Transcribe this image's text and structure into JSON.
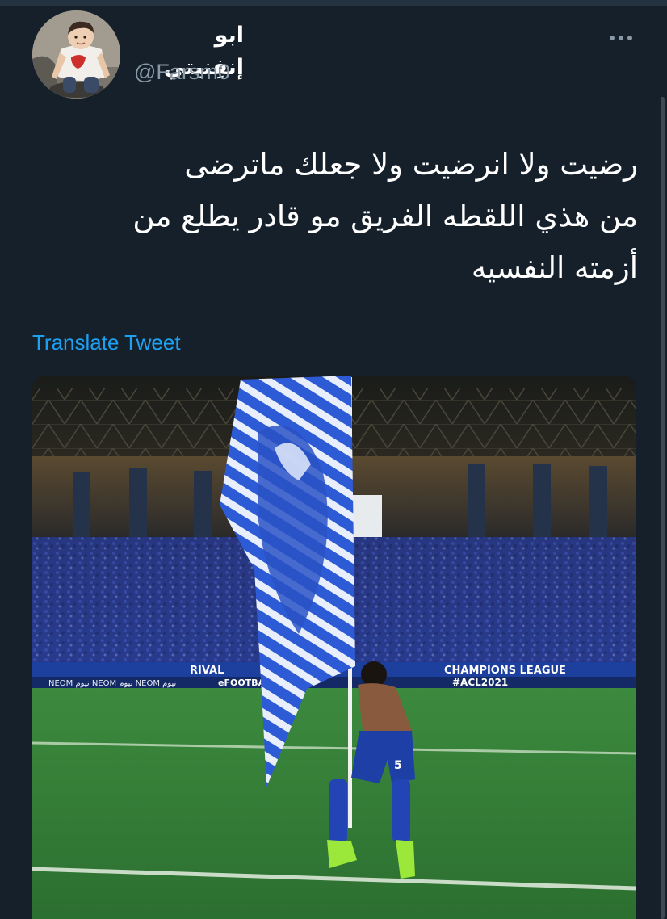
{
  "author": {
    "display_name": "ابو إنفِنيتي",
    "handle": "@Farsm0"
  },
  "menu": {
    "icon": "more-horizontal-icon"
  },
  "tweet": {
    "text": "رضيت ولا انرضيت ولا جعلك ماترضى\nمن هذي اللقطه الفريق مو قادر يطلع من\nأزمته النفسيه",
    "translate_label": "Translate Tweet"
  },
  "media": {
    "banner_left": "RIVAL",
    "banner_right": "CHAMPIONS LEAGUE",
    "ad_left": "NEOM نيوم NEOM نيوم NEOM نيوم",
    "ad_efootball": "eFOOTBALL",
    "hashtag": "#ACL2021",
    "player_number": "5"
  },
  "colors": {
    "background": "#15202b",
    "accent": "#1da1f2",
    "secondary_text": "#8899a6",
    "primary_text": "#ffffff",
    "flag_blue": "#2255c8",
    "pitch_green": "#2f7a34"
  }
}
